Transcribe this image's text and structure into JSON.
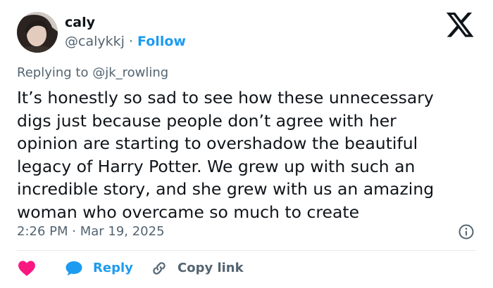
{
  "author": {
    "display_name": "caly",
    "handle": "@calykkj",
    "separator": "·",
    "follow_label": "Follow"
  },
  "reply_context": "Replying to @jk_rowling",
  "tweet": {
    "lines": [
      "It’s honestly so sad to see how these unnecessary",
      "digs just because people don’t agree with her",
      "opinion are starting to overshadow the beautiful",
      "legacy of Harry Potter. We grew up with such an",
      "incredible story, and she grew with us an amazing",
      "woman who overcame so much to create"
    ],
    "timestamp": "2:26 PM · Mar 19, 2025"
  },
  "actions": {
    "reply_label": "Reply",
    "copy_link_label": "Copy link"
  },
  "colors": {
    "accent": "#1d9bf0",
    "like": "#f91880",
    "text": "#0f1419",
    "muted": "#536471",
    "divider": "#e7e9eb"
  },
  "icons": {
    "logo": "x-logo-icon",
    "info": "info-icon",
    "like": "heart-icon",
    "reply": "speech-bubble-icon",
    "copy": "link-icon"
  }
}
